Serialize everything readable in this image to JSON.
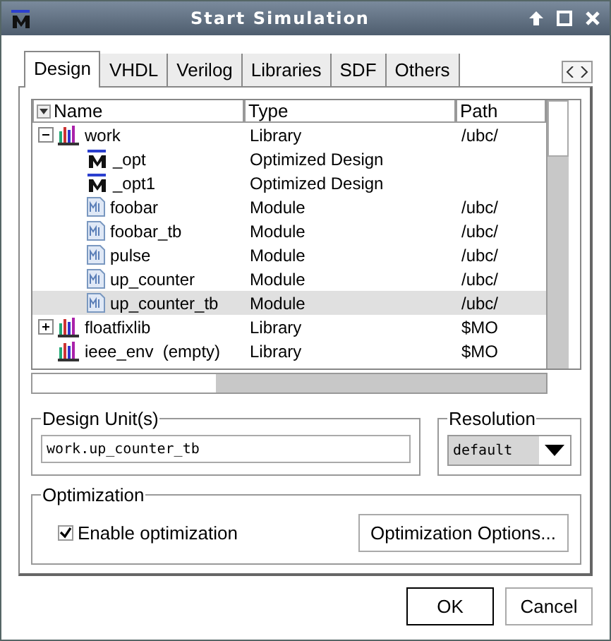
{
  "window": {
    "title": "Start Simulation"
  },
  "tabs": [
    {
      "label": "Design",
      "selected": true
    },
    {
      "label": "VHDL",
      "selected": false
    },
    {
      "label": "Verilog",
      "selected": false
    },
    {
      "label": "Libraries",
      "selected": false
    },
    {
      "label": "SDF",
      "selected": false
    },
    {
      "label": "Others",
      "selected": false
    }
  ],
  "table": {
    "columns": [
      "Name",
      "Type",
      "Path"
    ],
    "rows": [
      {
        "name": "work",
        "type": "Library",
        "path": "/ubc/",
        "kind": "library",
        "expanded": true,
        "selected": false,
        "children": [
          {
            "name": "_opt",
            "type": "Optimized Design",
            "kind": "optimized",
            "selected": false
          },
          {
            "name": "_opt1",
            "type": "Optimized Design",
            "kind": "optimized",
            "selected": false
          },
          {
            "name": "foobar",
            "type": "Module",
            "path": "/ubc/",
            "kind": "module",
            "selected": false
          },
          {
            "name": "foobar_tb",
            "type": "Module",
            "path": "/ubc/",
            "kind": "module",
            "selected": false
          },
          {
            "name": "pulse",
            "type": "Module",
            "path": "/ubc/",
            "kind": "module",
            "selected": false
          },
          {
            "name": "up_counter",
            "type": "Module",
            "path": "/ubc/",
            "kind": "module",
            "selected": false
          },
          {
            "name": "up_counter_tb",
            "type": "Module",
            "path": "/ubc/",
            "kind": "module",
            "selected": true
          }
        ]
      },
      {
        "name": "floatfixlib",
        "type": "Library",
        "path": "$MO",
        "kind": "library",
        "expanded": false,
        "selected": false
      },
      {
        "name": "ieee_env  (empty)",
        "type": "Library",
        "path": "$MO",
        "kind": "library",
        "selected": false
      }
    ]
  },
  "design_units": {
    "label": "Design Unit(s)",
    "value": "work.up_counter_tb"
  },
  "resolution": {
    "label": "Resolution",
    "value": "default"
  },
  "optimization": {
    "label": "Optimization",
    "checkbox": {
      "label": "Enable optimization",
      "checked": true
    },
    "options_button": "Optimization Options..."
  },
  "buttons": [
    {
      "label": "OK",
      "default": true
    },
    {
      "label": "Cancel",
      "default": false
    }
  ]
}
